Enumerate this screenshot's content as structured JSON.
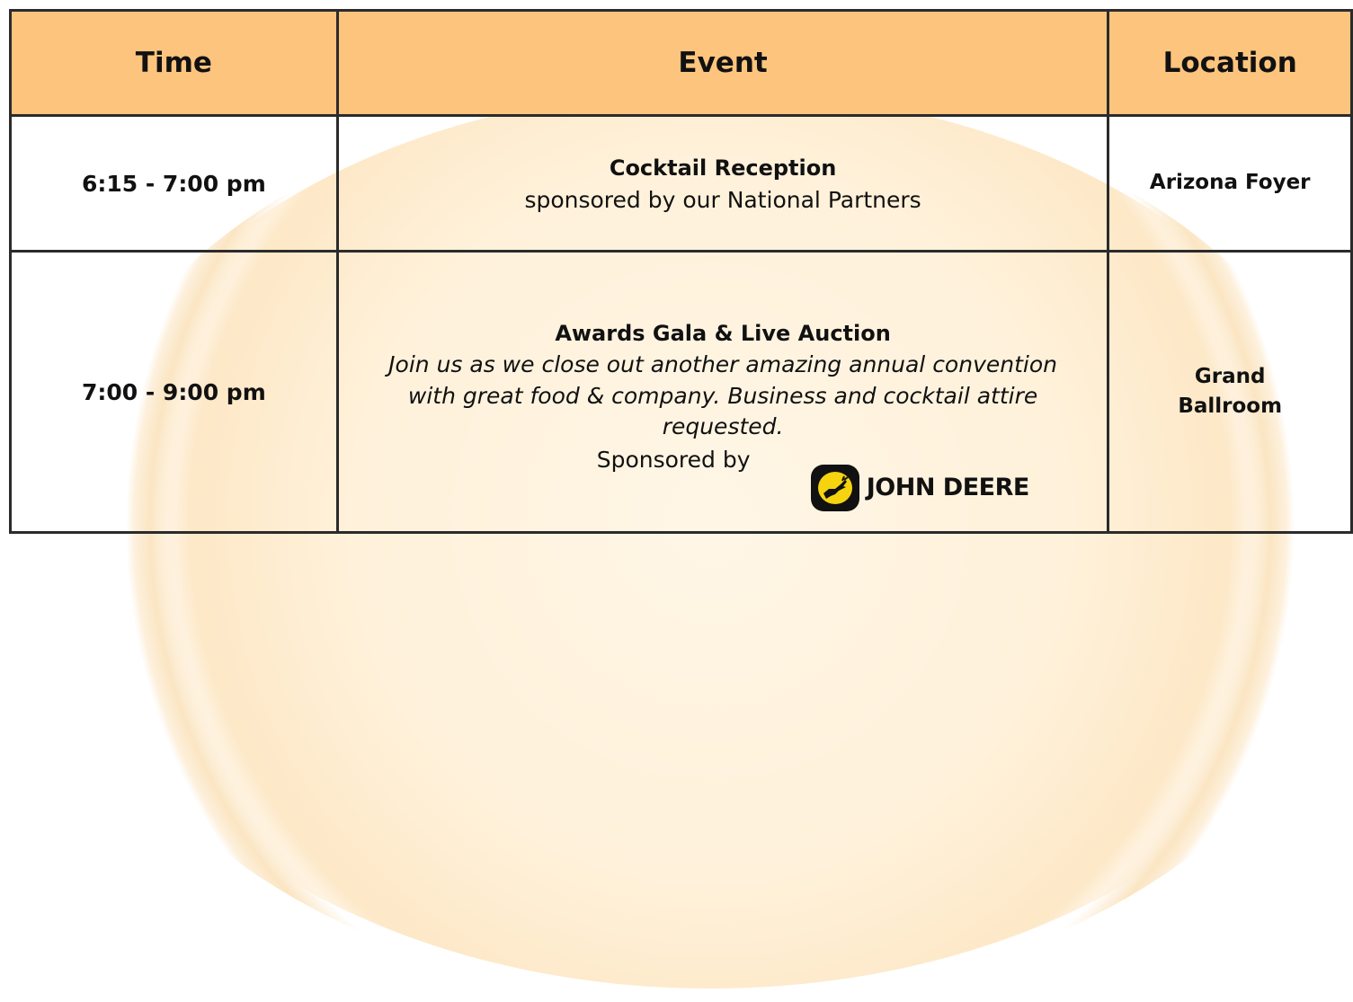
{
  "header": {
    "time_label": "Time",
    "event_label": "Event",
    "location_label": "Location"
  },
  "rows": [
    {
      "time": "6:15 - 7:00 pm",
      "event_title": "Cocktail Reception",
      "event_subtitle": "sponsored by our National Partners",
      "location": "Arizona Foyer"
    },
    {
      "time": "7:00 - 9:00 pm",
      "event_title": "Awards Gala & Live Auction",
      "event_description": "Join us as we close out another amazing annual convention with great food & company. Business and cocktail attire requested.",
      "sponsor_label": "Sponsored by",
      "sponsor_logo_text": "John Deere",
      "location": "Grand Ballroom"
    }
  ],
  "colors": {
    "header_bg": "#fdc47d",
    "border": "#2b2b2b",
    "background_glow": "#fff1da",
    "logo_yellow": "#f5d40f"
  },
  "icons": {
    "sponsor_logo": "john-deere-leaping-deer-logo"
  }
}
